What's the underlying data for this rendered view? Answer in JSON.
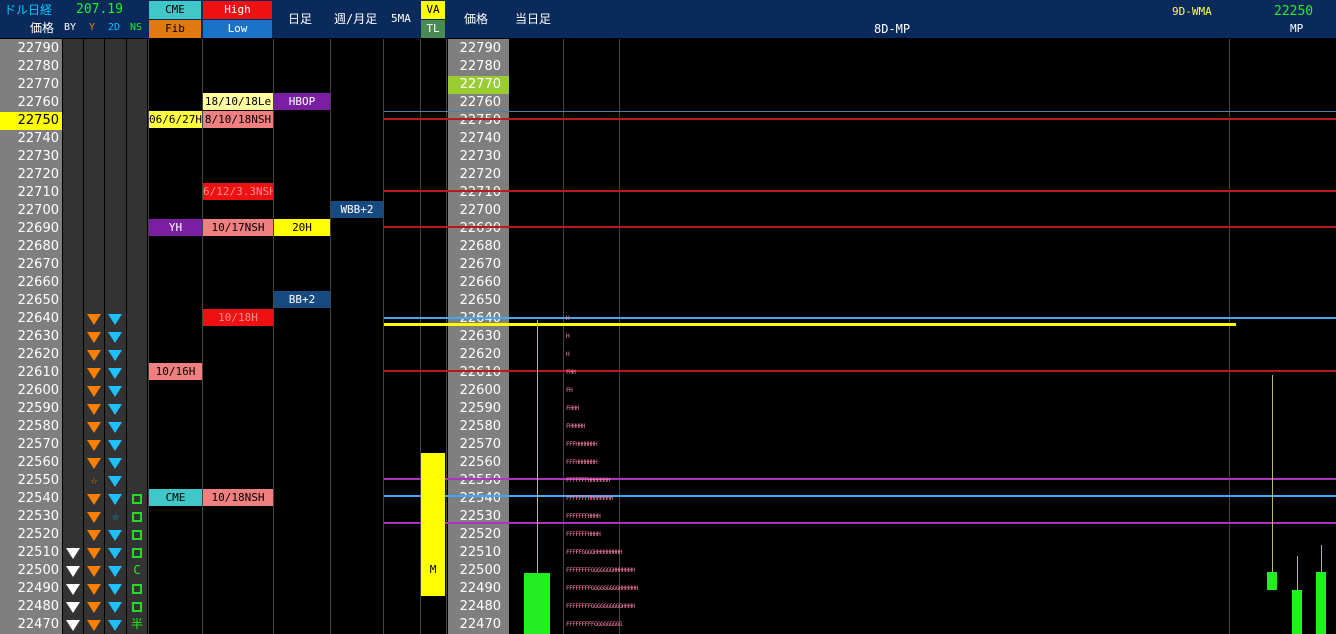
{
  "header": {
    "title": "ドル日経",
    "rate": "207.19",
    "price_label": "価格",
    "cols": [
      "BY",
      "Y",
      "2D",
      "NS"
    ],
    "cme": "CME",
    "fib": "Fib",
    "high": "High",
    "low": "Low",
    "daily": "日足",
    "weekly_monthly": "週/月足",
    "ma5": "5MA",
    "va": "VA",
    "tl": "TL",
    "price2": "価格",
    "today": "当日足",
    "mp_8d": "8D-MP",
    "wma_9d": "9D-WMA",
    "mp_value": "22250",
    "mp": "MP"
  },
  "prices": [
    "22790",
    "22780",
    "22770",
    "22760",
    "22750",
    "22740",
    "22730",
    "22720",
    "22710",
    "22700",
    "22690",
    "22680",
    "22670",
    "22660",
    "22650",
    "22640",
    "22630",
    "22620",
    "22610",
    "22600",
    "22590",
    "22580",
    "22570",
    "22560",
    "22550",
    "22540",
    "22530",
    "22520",
    "22510",
    "22500",
    "22490",
    "22480",
    "22470"
  ],
  "current_price": "22750",
  "labels": {
    "hbop": "HBOP",
    "hi_1018le": "18/10/18Le",
    "cme_0627": "06/6/27H",
    "hi_1018nsh": "8/10/18NSH",
    "hi_1213": "6/12/3.3NSH",
    "wbb2": "WBB+2",
    "yh": "YH",
    "hi_1017nsh": "10/17NSH",
    "h20": "20H",
    "bb2": "BB+2",
    "h1018": "10/18H",
    "h1016": "10/16H",
    "cme": "CME",
    "nsh1018": "10/18NSH",
    "va_m": "M",
    "star": "☆",
    "ns_c": "C",
    "ns_han": "半"
  },
  "tpo_rows": [
    {
      "price": "22640",
      "letters": "H"
    },
    {
      "price": "22630",
      "letters": "H"
    },
    {
      "price": "22620",
      "letters": "H"
    },
    {
      "price": "22610",
      "letters": "FHH"
    },
    {
      "price": "22600",
      "letters": "FH"
    },
    {
      "price": "22590",
      "letters": "FHHH"
    },
    {
      "price": "22580",
      "letters": "FHHHHH"
    },
    {
      "price": "22570",
      "letters": "FFFHHHHHHH"
    },
    {
      "price": "22560",
      "letters": "FFFHHHHHHH"
    },
    {
      "price": "22550",
      "letters": "FFFFFFFHHHHHHH"
    },
    {
      "price": "22540",
      "letters": "FFFFFFFHHHHHHHH"
    },
    {
      "price": "22530",
      "letters": "FFFFFFFHHHH"
    },
    {
      "price": "22520",
      "letters": "FFFFFFFHHHH"
    },
    {
      "price": "22510",
      "letters": "FFFFFGGGGHHHHHHHHH"
    },
    {
      "price": "22500",
      "letters": "FFFFFFFFGGGGGGGHHHHHHH"
    },
    {
      "price": "22490",
      "letters": "FFFFFFFFGGGGGGGGGHHHHHH"
    },
    {
      "price": "22480",
      "letters": "FFFFFFFFGGGGGGGGGGHHHH"
    },
    {
      "price": "22470",
      "letters": "FFFFFFFFFGGGGGGGGG"
    }
  ],
  "colors": {
    "header_bg": "#0b2a5c",
    "price_col": "#7f7f7f",
    "yellow": "#ffff00",
    "red": "#ff0000",
    "pink": "#f08080",
    "purple": "#7b1fa2",
    "teal": "#40c8c8",
    "orange": "#ff7f00",
    "cyan": "#00c0ff",
    "green": "#22ee22"
  }
}
